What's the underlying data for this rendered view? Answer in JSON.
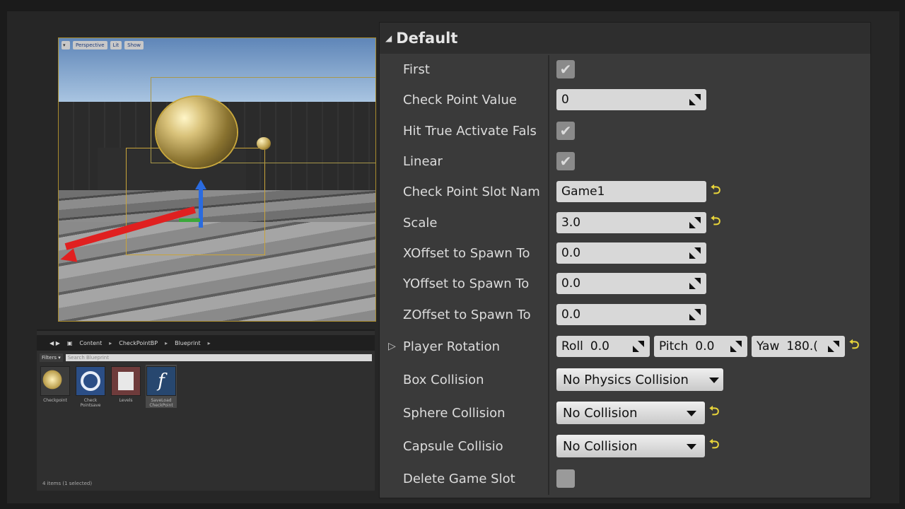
{
  "viewport": {
    "toolbar": [
      "Perspective",
      "Lit",
      "Show"
    ]
  },
  "content_browser": {
    "path": [
      "Content",
      "CheckPointBP",
      "Blueprint"
    ],
    "filters_label": "Filters ▾",
    "search_placeholder": "Search Blueprint",
    "assets": [
      {
        "label": "Checkpoint",
        "icon": "golden-sphere-icon"
      },
      {
        "label": "Check Pointsave",
        "icon": "ring-icon"
      },
      {
        "label": "Levels",
        "icon": "list-icon"
      },
      {
        "label": "SaveLoad CheckPoint",
        "icon": "function-icon"
      }
    ],
    "status": "4 items (1 selected)"
  },
  "details": {
    "category": "Default",
    "rows": {
      "first": {
        "label": "First",
        "checked": true
      },
      "check_point_value": {
        "label": "Check Point Value",
        "value": "0"
      },
      "hit_true": {
        "label": "Hit True Activate Fals",
        "checked": true
      },
      "linear": {
        "label": "Linear",
        "checked": true
      },
      "slot_name": {
        "label": "Check Point Slot Nam",
        "value": "Game1"
      },
      "scale": {
        "label": "Scale",
        "value": "3.0"
      },
      "x_offset": {
        "label": "XOffset to Spawn To",
        "value": "0.0"
      },
      "y_offset": {
        "label": "YOffset to Spawn To",
        "value": "0.0"
      },
      "z_offset": {
        "label": "ZOffset to Spawn To",
        "value": "0.0"
      },
      "player_rotation": {
        "label": "Player Rotation",
        "roll_label": "Roll",
        "roll": "0.0",
        "pitch_label": "Pitch",
        "pitch": "0.0",
        "yaw_label": "Yaw",
        "yaw": "180.("
      },
      "box_collision": {
        "label": "Box Collision",
        "value": "No Physics Collision"
      },
      "sphere_collision": {
        "label": "Sphere Collision",
        "value": "No Collision"
      },
      "capsule_collision": {
        "label": "Capsule Collisio",
        "value": "No Collision"
      },
      "delete_game_slot": {
        "label": "Delete Game Slot",
        "checked": false
      }
    },
    "check_glyph": "✔",
    "reset_glyph": "⮌",
    "colors": {
      "reset_arrow": "#e8d43a",
      "panel_bg": "#3a3a3a"
    }
  }
}
